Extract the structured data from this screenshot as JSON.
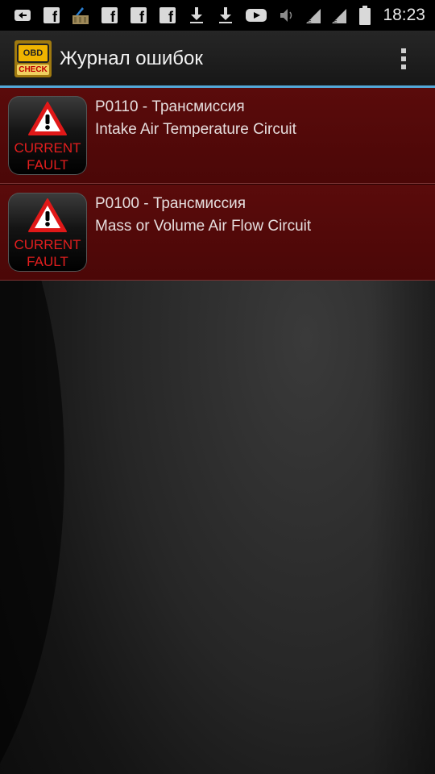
{
  "status_bar": {
    "time": "18:23",
    "left_icons": [
      "keyboard-icon",
      "facebook-icon",
      "cleaner-icon",
      "facebook-icon",
      "facebook-icon",
      "facebook-icon",
      "download-icon",
      "download-icon",
      "youtube-icon"
    ],
    "right_icons": [
      "volume-muted-icon",
      "signal-icon",
      "signal-icon",
      "battery-icon"
    ]
  },
  "action_bar": {
    "app_icon_text": {
      "obd": "OBD",
      "check": "CHECK"
    },
    "title": "Журнал ошибок",
    "accent_color": "#53a8d8"
  },
  "faults": [
    {
      "badge_line1": "CURRENT",
      "badge_line2": "FAULT",
      "code": "P0110 - Трансмиссия",
      "description": "Intake Air Temperature Circuit"
    },
    {
      "badge_line1": "CURRENT",
      "badge_line2": "FAULT",
      "code": "P0100 - Трансмиссия",
      "description": "Mass or Volume Air Flow Circuit"
    }
  ],
  "colors": {
    "row_background": "#560909",
    "badge_text": "#e31e1e"
  }
}
